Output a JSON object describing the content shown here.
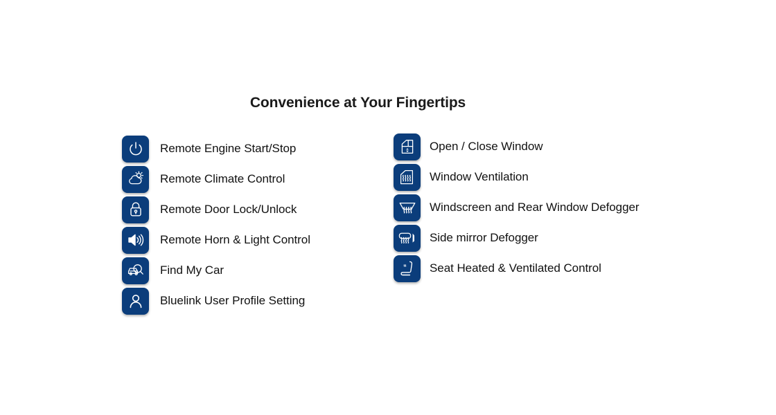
{
  "page": {
    "title": "Convenience at Your Fingertips",
    "background_color": "#ffffff",
    "tile_color": "#0b3d7b",
    "text_color": "#111111"
  },
  "columns": {
    "left": [
      {
        "label": "Remote Engine Start/Stop",
        "icon": "power-icon"
      },
      {
        "label": "Remote Climate Control",
        "icon": "cloud-sun-icon"
      },
      {
        "label": "Remote Door Lock/Unlock",
        "icon": "lock-icon"
      },
      {
        "label": "Remote Horn & Light Control",
        "icon": "horn-speaker-icon"
      },
      {
        "label": "Find My Car",
        "icon": "car-search-icon"
      },
      {
        "label": "Bluelink User Profile Setting",
        "icon": "user-profile-icon"
      }
    ],
    "right": [
      {
        "label": "Open / Close Window",
        "icon": "window-open-close-icon"
      },
      {
        "label": "Window Ventilation",
        "icon": "window-ventilation-icon"
      },
      {
        "label": "Windscreen and Rear Window Defogger",
        "icon": "windscreen-defogger-icon"
      },
      {
        "label": "Side mirror Defogger",
        "icon": "side-mirror-defogger-icon"
      },
      {
        "label": "Seat Heated & Ventilated Control",
        "icon": "seat-heat-vent-icon"
      }
    ]
  }
}
